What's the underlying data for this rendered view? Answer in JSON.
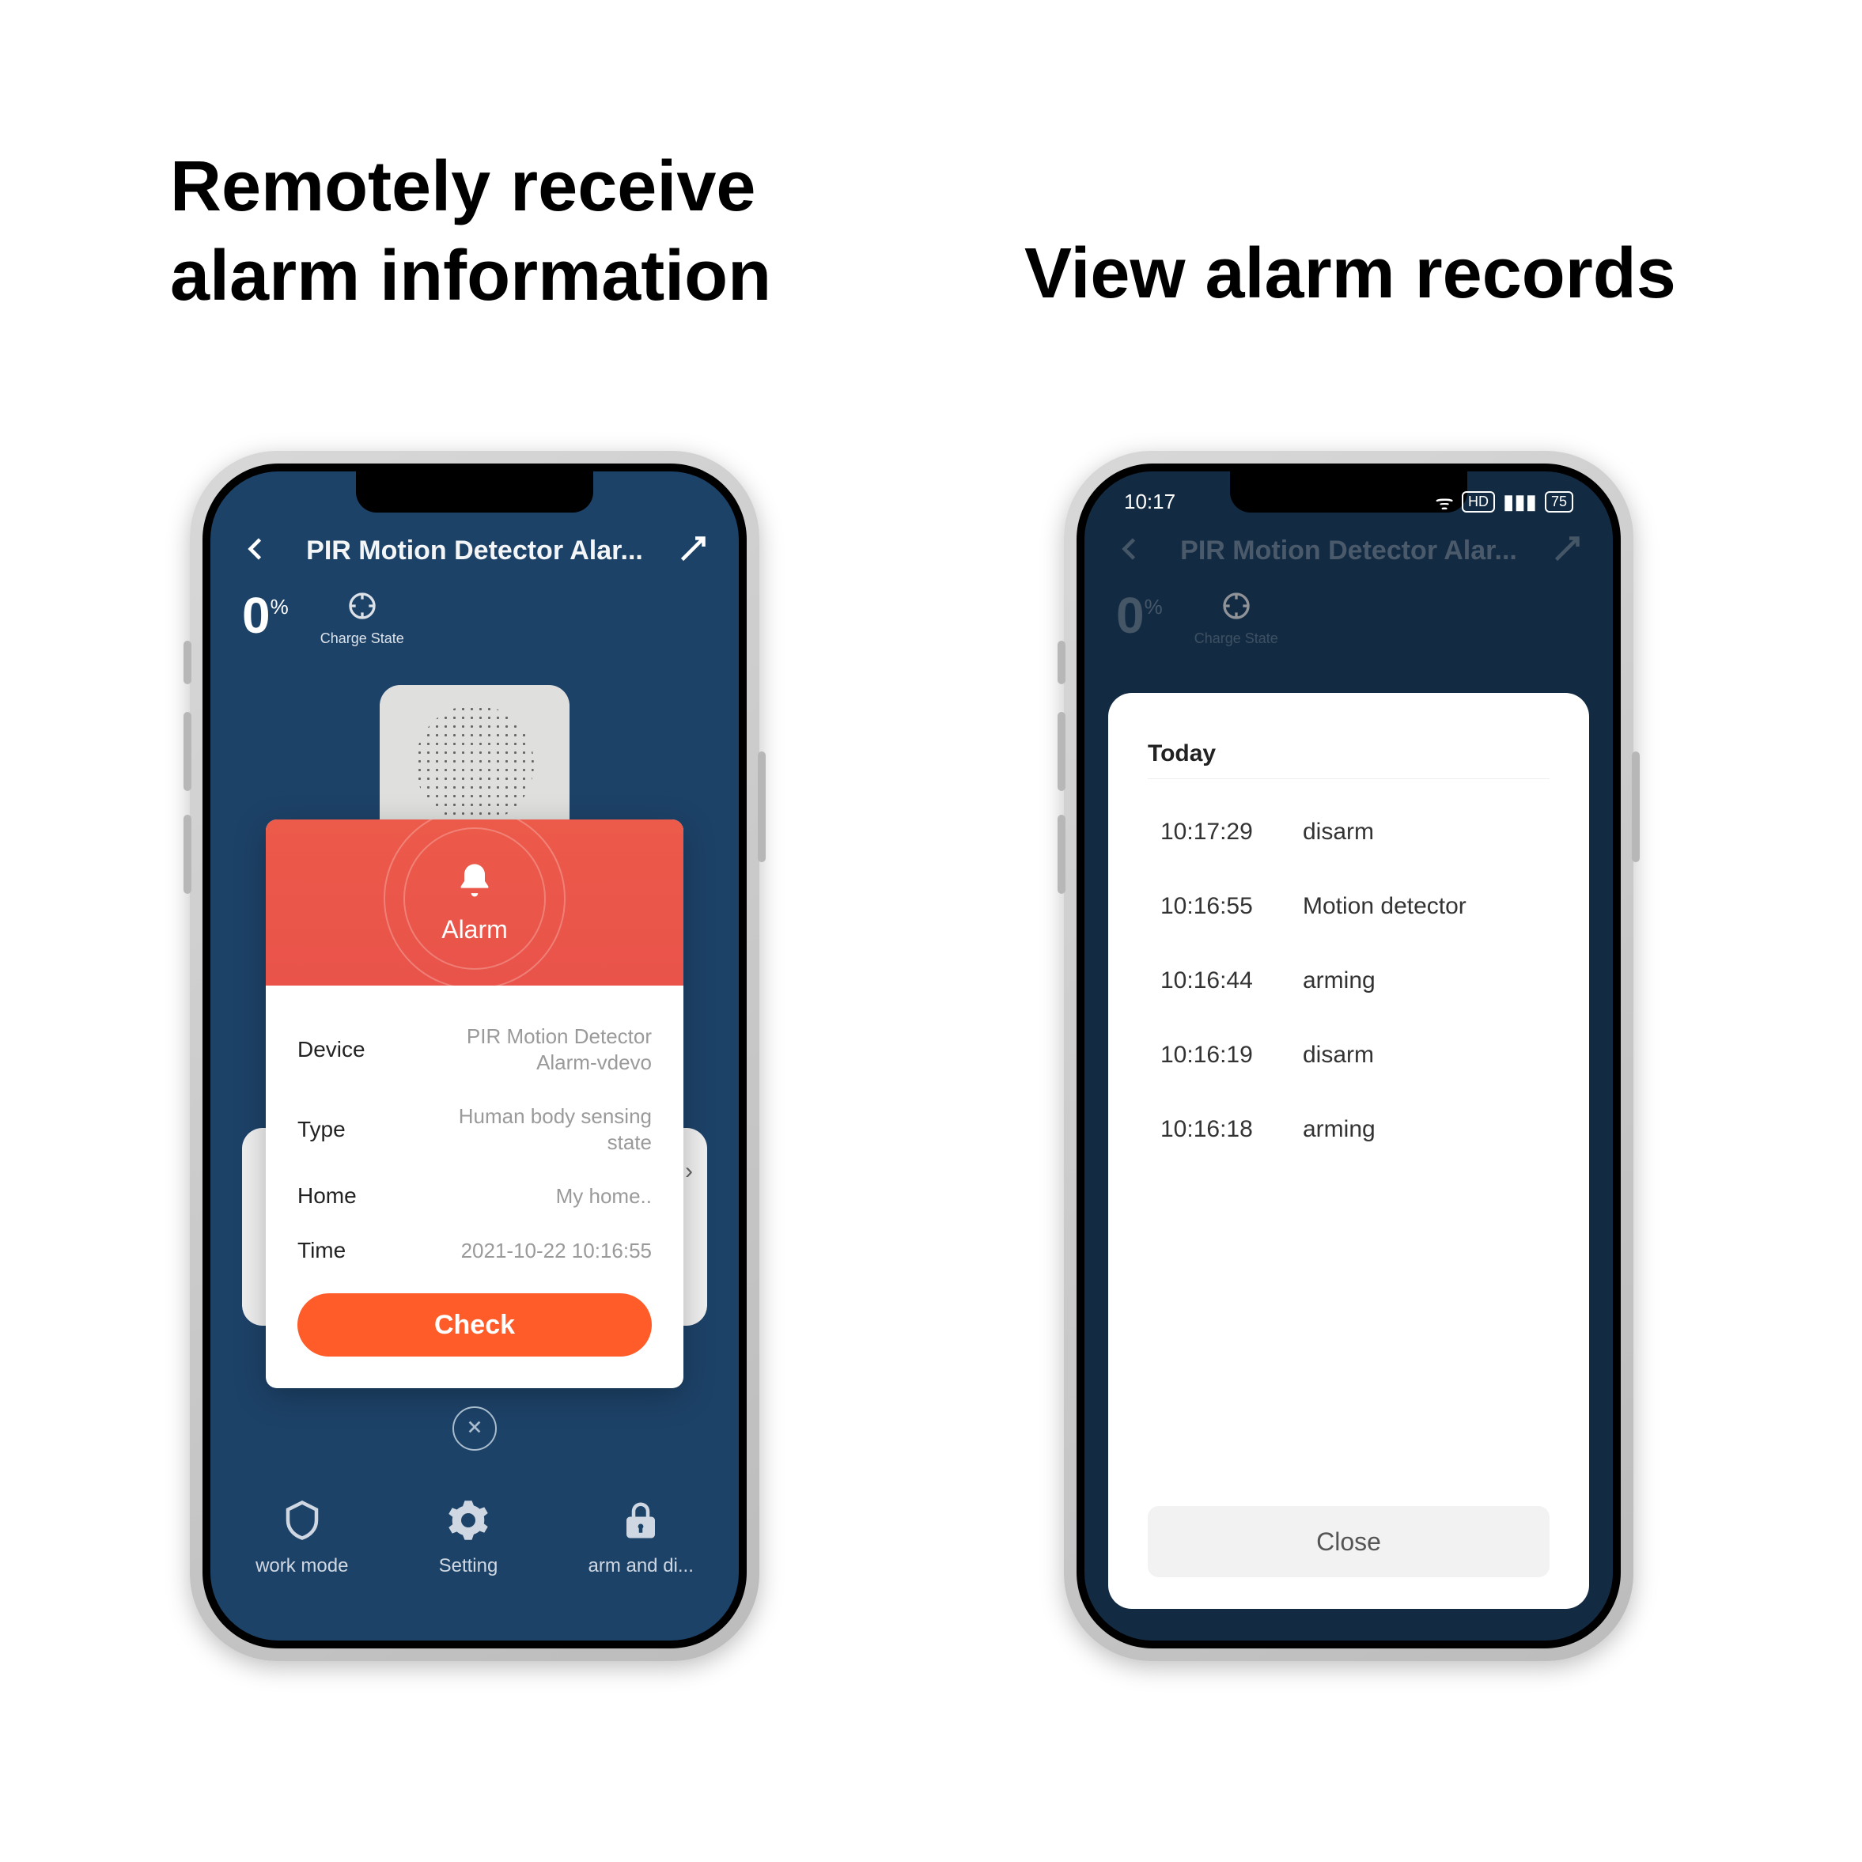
{
  "headlines": {
    "left": "Remotely receive alarm information",
    "right": "View alarm records"
  },
  "phone1": {
    "nav_title": "PIR Motion Detector Alar...",
    "battery_pct_value": "0",
    "battery_pct_symbol": "%",
    "charge_label": "Charge State",
    "alarm": {
      "title": "Alarm",
      "device_k": "Device",
      "device_v": "PIR Motion Detector Alarm-vdevo",
      "type_k": "Type",
      "type_v": "Human body sensing state",
      "home_k": "Home",
      "home_v": "My home..",
      "time_k": "Time",
      "time_v": "2021-10-22 10:16:55",
      "check_btn": "Check"
    },
    "tabs": {
      "work": "work mode",
      "setting": "Setting",
      "arm": "arm and di..."
    }
  },
  "phone2": {
    "status_time": "10:17",
    "status_batt": "75",
    "nav_title": "PIR Motion Detector Alar...",
    "battery_pct_value": "0",
    "battery_pct_symbol": "%",
    "charge_label": "Charge State",
    "records": {
      "section": "Today",
      "rows": [
        {
          "time": "10:17:29",
          "event": "disarm"
        },
        {
          "time": "10:16:55",
          "event": "Motion detector"
        },
        {
          "time": "10:16:44",
          "event": "arming"
        },
        {
          "time": "10:16:19",
          "event": "disarm"
        },
        {
          "time": "10:16:18",
          "event": "arming"
        }
      ],
      "close": "Close"
    }
  }
}
